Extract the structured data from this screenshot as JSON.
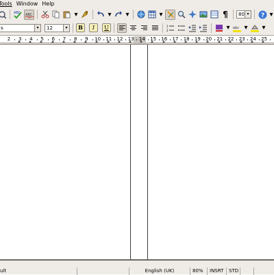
{
  "menu": {
    "tools_label": "Tools",
    "window_label": "Window",
    "help_label": "Help"
  },
  "toolbar": {
    "zoom_value": "80%",
    "spellcheck_label": "ABC",
    "autospell_label": "ABC",
    "pilcrow": "¶",
    "help_glyph": "?"
  },
  "format_toolbar": {
    "font_name_fragment": "s",
    "font_size": "12",
    "bold_label": "B",
    "italic_label": "I",
    "underline_label": "U"
  },
  "ruler": {
    "labels": [
      "2",
      "3",
      "4",
      "5",
      "6",
      "7",
      "8",
      "9",
      "10",
      "11",
      "12",
      "13",
      "14",
      "15",
      "16",
      "17",
      "18",
      "19",
      "20",
      "21",
      "22",
      "23",
      "24",
      "25"
    ]
  },
  "statusbar": {
    "page_style": "ult",
    "language": "English (UK)",
    "zoom": "80%",
    "insert_mode": "INSRT",
    "selection_mode": "STD"
  },
  "colors": {
    "chrome": "#efebe7",
    "border": "#8a857e",
    "highlight_yellow": "#f6f0b8"
  }
}
